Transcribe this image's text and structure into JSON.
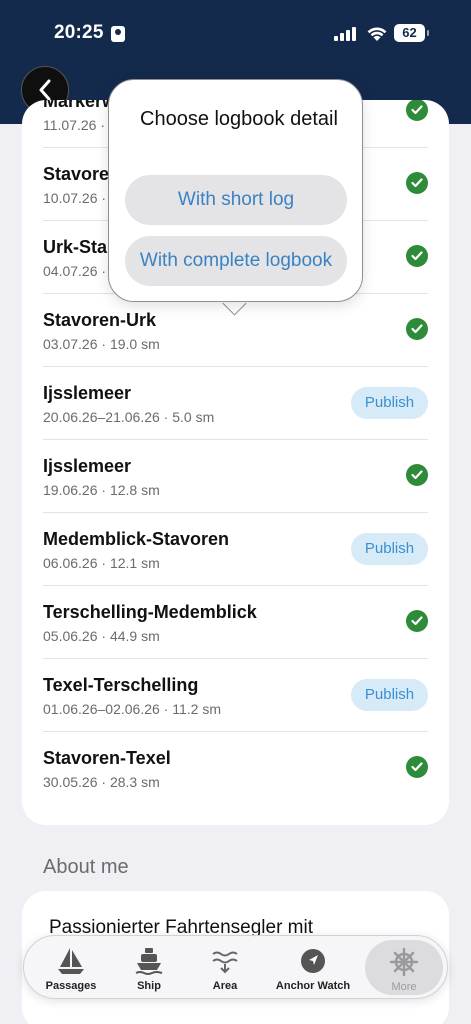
{
  "status_bar": {
    "time": "20:25",
    "battery": "62"
  },
  "popover": {
    "title": "Choose logbook detail",
    "options": [
      {
        "label": "With short log"
      },
      {
        "label": "With complete logbook"
      }
    ]
  },
  "logbook": {
    "items": [
      {
        "title": "Markerw",
        "meta": "11.07.26 ·",
        "status": "published"
      },
      {
        "title": "Stavore",
        "meta": "10.07.26 ·",
        "status": "published"
      },
      {
        "title": "Urk-Sta",
        "meta": "04.07.26 · 2",
        "status": "published"
      },
      {
        "title": "Stavoren-Urk",
        "meta": "03.07.26 · 19.0 sm",
        "status": "published"
      },
      {
        "title": "Ijsslemeer",
        "meta": "20.06.26–21.06.26 · 5.0 sm",
        "status": "publish"
      },
      {
        "title": "Ijsslemeer",
        "meta": "19.06.26 · 12.8 sm",
        "status": "published"
      },
      {
        "title": "Medemblick-Stavoren",
        "meta": "06.06.26 · 12.1 sm",
        "status": "publish"
      },
      {
        "title": "Terschelling-Medemblick",
        "meta": "05.06.26 · 44.9 sm",
        "status": "published"
      },
      {
        "title": "Texel-Terschelling",
        "meta": "01.06.26–02.06.26 · 11.2 sm",
        "status": "publish"
      },
      {
        "title": "Stavoren-Texel",
        "meta": "30.05.26 · 28.3 sm",
        "status": "published"
      }
    ],
    "publish_label": "Publish"
  },
  "about": {
    "section_title": "About me",
    "text": "Passionierter Fahrtensegler mit"
  },
  "tab_bar": {
    "tabs": [
      {
        "label": "Passages",
        "icon": "sailboat-icon"
      },
      {
        "label": "Ship",
        "icon": "ship-icon"
      },
      {
        "label": "Area",
        "icon": "waves-icon"
      },
      {
        "label": "Anchor Watch",
        "icon": "location-arrow-icon"
      },
      {
        "label": "More",
        "icon": "helm-icon",
        "selected": true
      }
    ]
  },
  "colors": {
    "header": "#142a4d",
    "check_green": "#2e8b3a",
    "publish_bg": "#d6eaf8",
    "publish_text": "#3b8fd1",
    "popover_button_text": "#3b82c4"
  }
}
